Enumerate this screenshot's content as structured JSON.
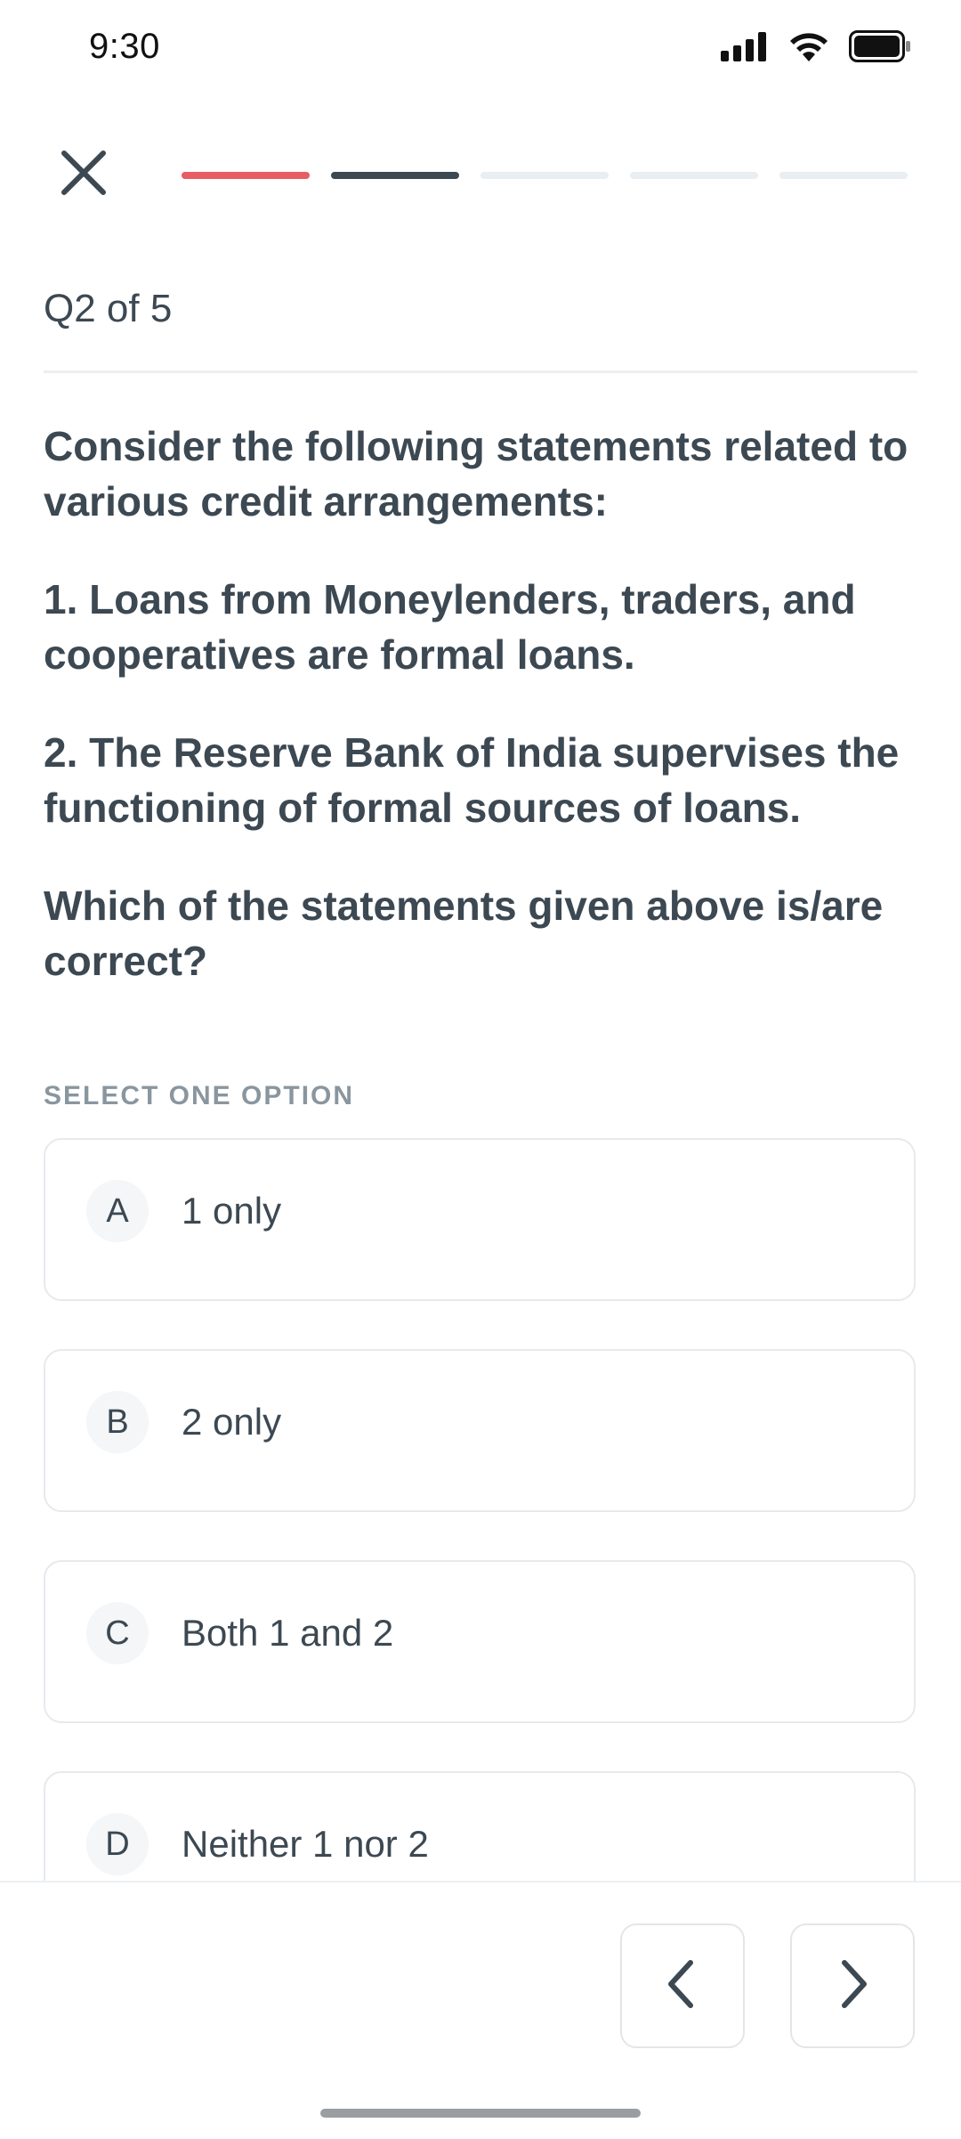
{
  "status_bar": {
    "time": "9:30",
    "icons": [
      "signal-icon",
      "wifi-icon",
      "battery-icon"
    ]
  },
  "header": {
    "close_icon": "close-icon",
    "progress": {
      "total": 5,
      "segments": [
        "answered",
        "current",
        "pending",
        "pending",
        "pending"
      ],
      "colors": {
        "answered": "#e85c63",
        "current": "#3c4852",
        "pending": "#e9eef2"
      }
    }
  },
  "quiz": {
    "counter": "Q2 of 5",
    "question": {
      "intro": "Consider the following statements related to various credit arrangements:",
      "statement_1": "1. Loans from Moneylenders, traders, and cooperatives are formal loans.",
      "statement_2": "2. The Reserve Bank of India supervises the functioning of formal sources of loans.",
      "prompt": "Which of the statements given above is/are correct?"
    },
    "select_label": "SELECT ONE OPTION",
    "options": [
      {
        "letter": "A",
        "text": "1 only"
      },
      {
        "letter": "B",
        "text": "2 only"
      },
      {
        "letter": "C",
        "text": "Both 1 and 2"
      },
      {
        "letter": "D",
        "text": "Neither 1 nor 2"
      }
    ]
  },
  "navigation": {
    "prev_icon": "chevron-left-icon",
    "next_icon": "chevron-right-icon"
  }
}
